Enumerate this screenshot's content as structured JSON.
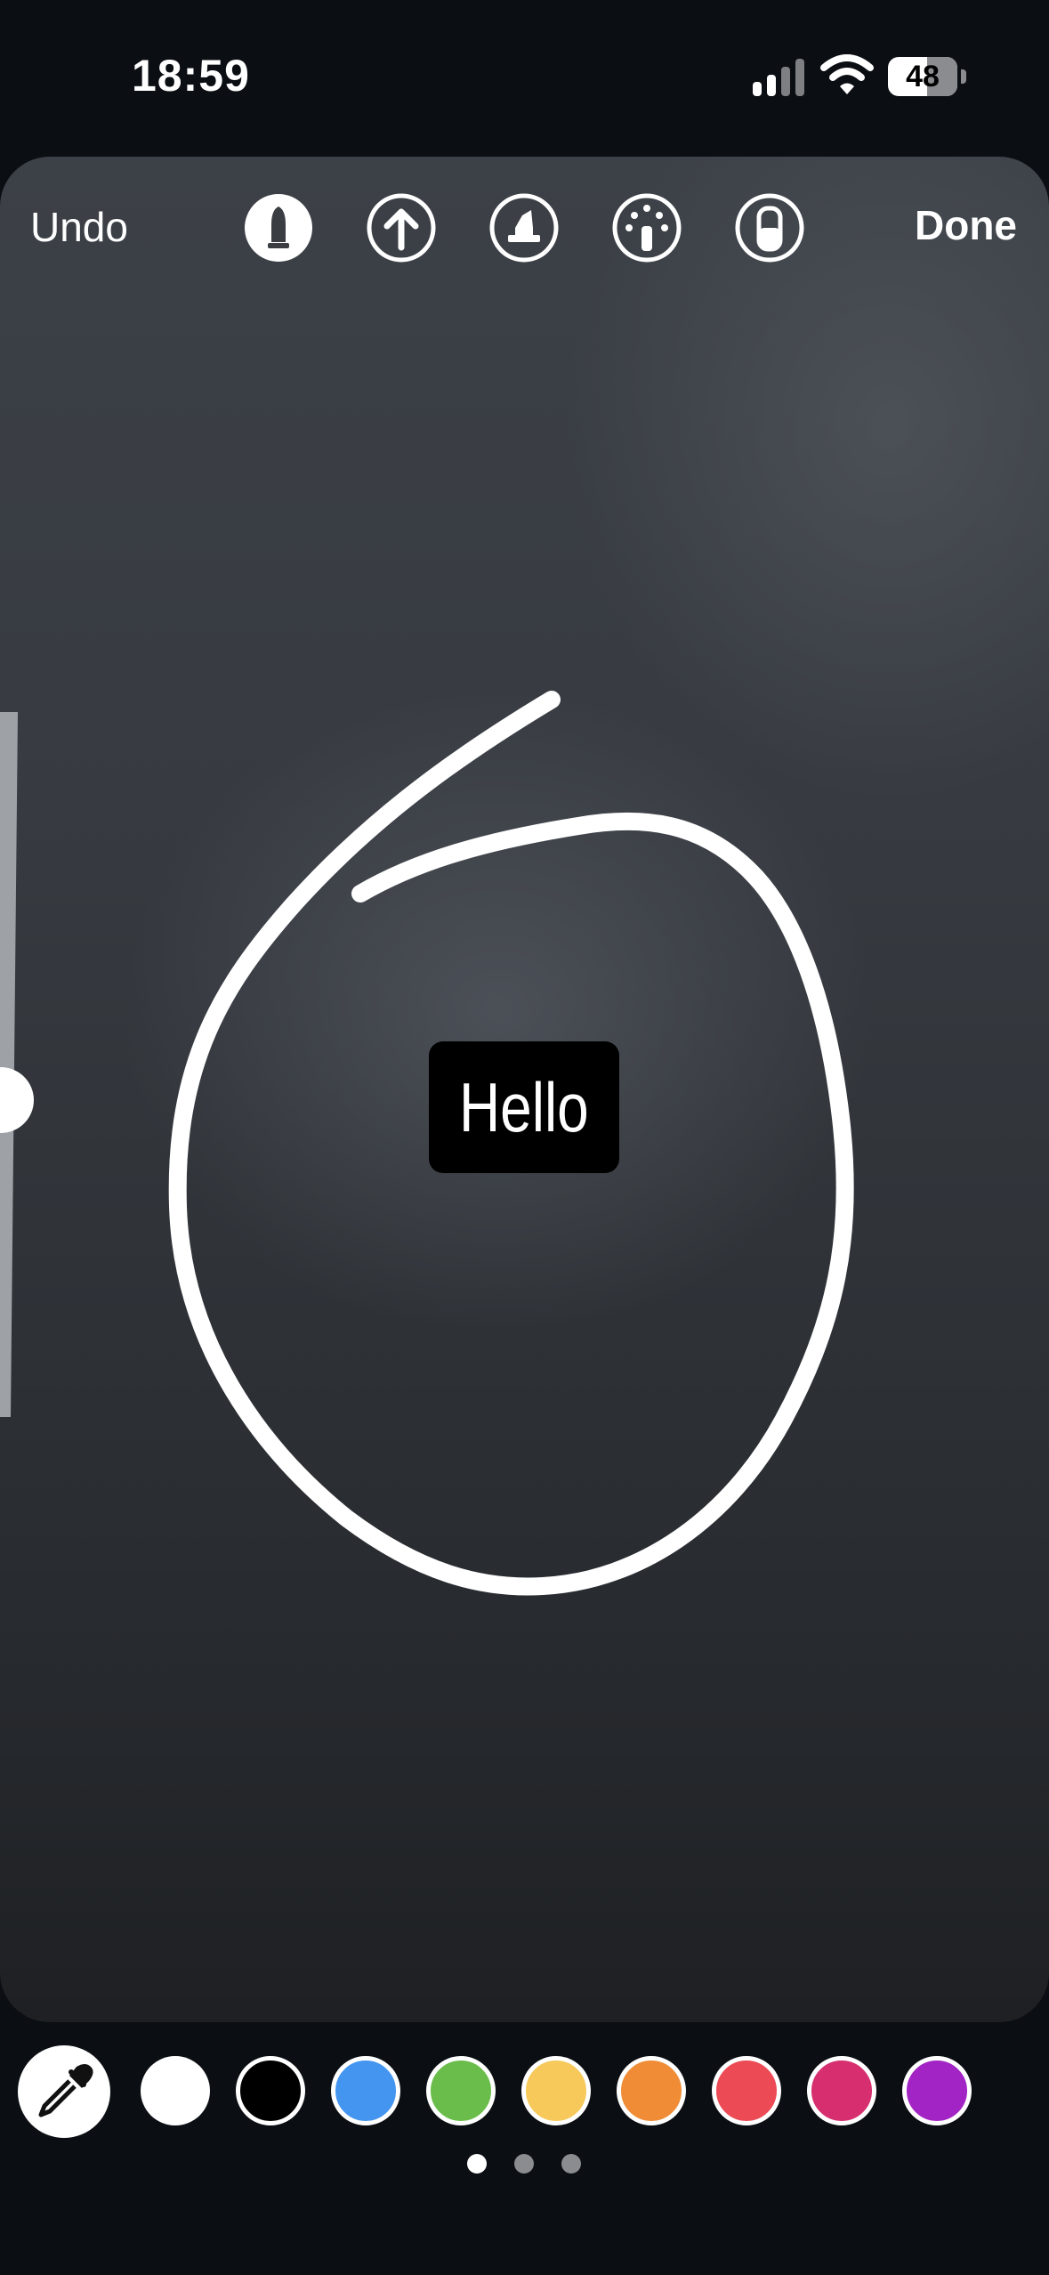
{
  "status_bar": {
    "time": "18:59",
    "battery": "48"
  },
  "toolbar": {
    "undo_label": "Undo",
    "done_label": "Done",
    "tools": [
      "marker-tool",
      "arrow-tool",
      "highlighter-tool",
      "neon-tool",
      "eraser-tool"
    ],
    "selected_tool": "marker-tool"
  },
  "canvas": {
    "sticker_text": "Hello",
    "brush_size_level": 0.45
  },
  "palette": {
    "colors": [
      "#ffffff",
      "#000000",
      "#4495f0",
      "#6abd4b",
      "#f6c95a",
      "#ef8c35",
      "#ec4a55",
      "#d62e6e",
      "#a324c5"
    ],
    "page_indicator": {
      "pages": 3,
      "current": 1
    }
  }
}
